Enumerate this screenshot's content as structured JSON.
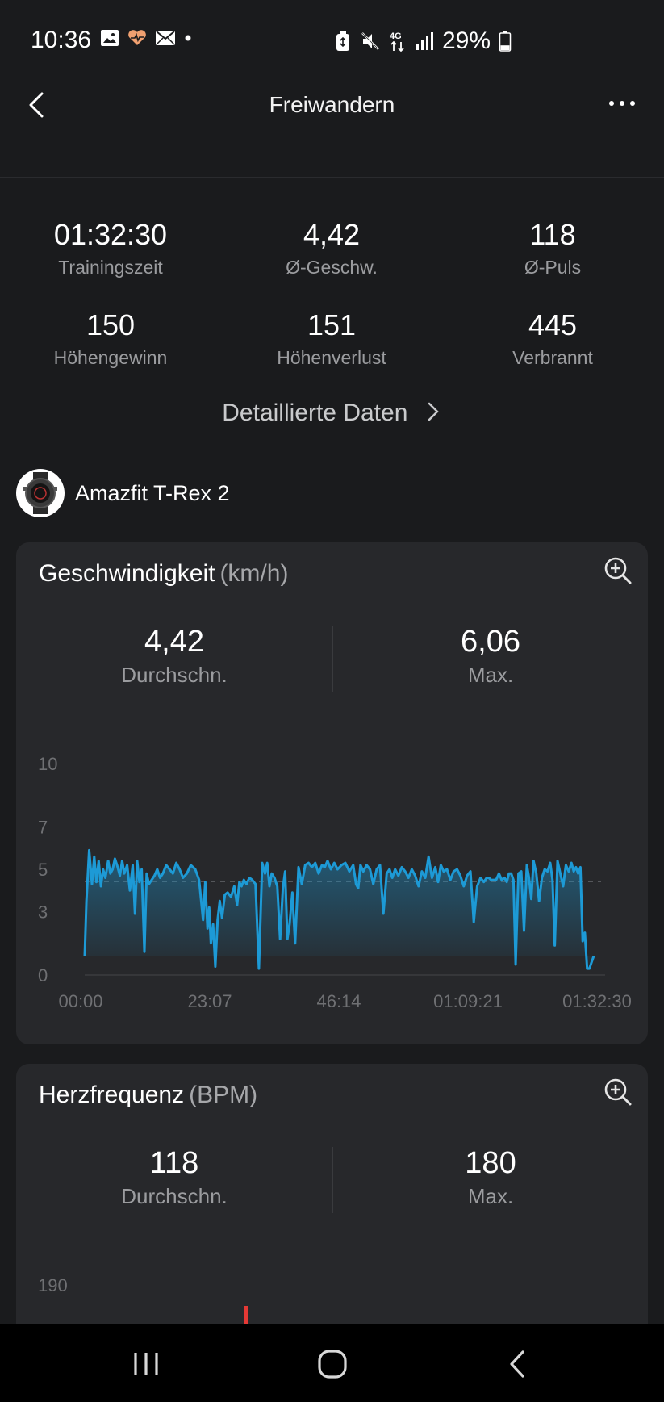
{
  "status_bar": {
    "time": "10:36",
    "network": "4G",
    "battery_percent": "29%",
    "battery_level": 0.29
  },
  "header": {
    "title": "Freiwandern"
  },
  "summary": [
    {
      "value": "01:32:30",
      "label": "Trainingszeit"
    },
    {
      "value": "4,42",
      "label": "Ø-Geschw."
    },
    {
      "value": "118",
      "label": "Ø-Puls"
    },
    {
      "value": "150",
      "label": "Höhengewinn"
    },
    {
      "value": "151",
      "label": "Höhenverlust"
    },
    {
      "value": "445",
      "label": "Verbrannt"
    }
  ],
  "detail_link": "Detaillierte Daten",
  "device": {
    "name": "Amazfit T-Rex 2"
  },
  "speed_card": {
    "title": "Geschwindigkeit",
    "unit": "(km/h)",
    "avg_value": "4,42",
    "avg_label": "Durchschn.",
    "max_value": "6,06",
    "max_label": "Max."
  },
  "heart_card": {
    "title": "Herzfrequenz",
    "unit": "(BPM)",
    "avg_value": "118",
    "avg_label": "Durchschn.",
    "max_value": "180",
    "max_label": "Max.",
    "y_tick": "190"
  },
  "chart_data": {
    "type": "area",
    "title": "Geschwindigkeit (km/h)",
    "xlabel": "",
    "ylabel": "",
    "y_ticks": [
      "0",
      "3",
      "5",
      "7",
      "10"
    ],
    "x_ticks": [
      "00:00",
      "23:07",
      "46:14",
      "01:09:21",
      "01:32:30"
    ],
    "ylim": [
      0,
      10
    ],
    "xlim_minutes": [
      0,
      92.5
    ],
    "color": "#1d9ad6",
    "series": [
      {
        "x_minutes": [
          0,
          0.3,
          0.8,
          1.3,
          1.7,
          2.1,
          2.5,
          2.9,
          3.3,
          3.7,
          4.2,
          4.6,
          5.0,
          5.4,
          5.8,
          6.3,
          6.7,
          7.1,
          7.6,
          8.1,
          8.6,
          9.0,
          9.4,
          9.8,
          10.2,
          10.7,
          11.1,
          11.5,
          12.0,
          12.5,
          13.0,
          13.5,
          14.0,
          14.6,
          15.2,
          15.8,
          16.4,
          17.0,
          17.6,
          18.3,
          19.0,
          19.8,
          20.5,
          21.2,
          21.6,
          22.0,
          22.3,
          22.6,
          23.0,
          23.4,
          23.8,
          24.2,
          24.6,
          25.1,
          25.6,
          26.2,
          26.8,
          27.3,
          27.7,
          28.1,
          28.5,
          29.0,
          29.5,
          30.0,
          30.6,
          31.2,
          31.8,
          32.3,
          32.7,
          33.1,
          33.5,
          34.0,
          34.5,
          35.0,
          35.5,
          35.9,
          36.3,
          36.7,
          37.2,
          37.7,
          38.3,
          38.9,
          39.5,
          40.1,
          40.7,
          41.3,
          41.9,
          42.5,
          43.0,
          43.5,
          44.1,
          44.7,
          45.3,
          46.0,
          46.7,
          47.4,
          48.1,
          48.6,
          49.0,
          49.4,
          49.9,
          50.5,
          51.1,
          51.7,
          52.3,
          52.9,
          53.5,
          54.1,
          54.6,
          55.1,
          55.6,
          56.2,
          56.8,
          57.4,
          58.0,
          58.6,
          59.2,
          59.8,
          60.4,
          61.0,
          61.6,
          62.2,
          62.8,
          63.3,
          63.8,
          64.3,
          64.9,
          65.5,
          66.1,
          66.7,
          67.3,
          67.9,
          68.5,
          69.1,
          69.7,
          70.3,
          70.9,
          71.5,
          72.0,
          72.4,
          72.8,
          73.2,
          73.7,
          74.2,
          74.7,
          75.2,
          75.6,
          76.0,
          76.4,
          76.8,
          77.2,
          77.7,
          78.2,
          78.7,
          79.2,
          79.6,
          80.0,
          80.4,
          80.9,
          81.4,
          81.9,
          82.4,
          82.9,
          83.4,
          83.8,
          84.2,
          84.7,
          85.2,
          85.7,
          86.2,
          86.7,
          87.2,
          87.6,
          88.0,
          88.4,
          88.8,
          89.2,
          89.6,
          90.0,
          90.4,
          90.8,
          91.2,
          91.6,
          92.0,
          92.5
        ],
        "values": [
          0.9,
          3.5,
          5.9,
          4.3,
          5.6,
          4.4,
          5.4,
          4.2,
          5.0,
          4.6,
          5.4,
          4.8,
          5.0,
          5.5,
          5.2,
          4.7,
          5.4,
          4.8,
          5.2,
          4.0,
          5.2,
          2.9,
          5.4,
          4.4,
          5.0,
          1.1,
          4.8,
          4.3,
          4.5,
          4.7,
          5.0,
          4.6,
          4.8,
          5.2,
          5.0,
          4.8,
          5.3,
          5.0,
          4.6,
          4.8,
          5.2,
          5.0,
          4.5,
          2.6,
          4.4,
          2.2,
          3.2,
          1.5,
          2.4,
          0.4,
          2.6,
          3.5,
          2.7,
          3.8,
          3.9,
          3.7,
          4.2,
          3.3,
          4.4,
          4.2,
          4.5,
          4.3,
          4.6,
          4.5,
          4.3,
          0.3,
          5.3,
          4.8,
          5.3,
          4.2,
          4.8,
          4.6,
          4.2,
          1.7,
          4.1,
          4.9,
          1.7,
          2.4,
          3.9,
          1.5,
          5.1,
          4.3,
          5.2,
          5.3,
          5.1,
          5.3,
          4.8,
          5.2,
          5.1,
          5.4,
          5.0,
          5.3,
          5.0,
          5.2,
          5.3,
          4.9,
          5.2,
          4.3,
          4.1,
          5.2,
          4.9,
          5.2,
          5.0,
          4.3,
          5.0,
          5.2,
          2.9,
          4.8,
          5.0,
          4.6,
          5.0,
          4.7,
          5.1,
          4.9,
          4.6,
          5.0,
          4.7,
          4.2,
          4.9,
          4.6,
          5.6,
          4.6,
          5.1,
          4.4,
          5.2,
          4.9,
          5.0,
          4.5,
          4.9,
          5.0,
          4.7,
          4.2,
          4.7,
          4.9,
          2.5,
          4.2,
          4.6,
          4.4,
          4.6,
          4.6,
          4.5,
          4.5,
          4.5,
          4.8,
          4.5,
          4.6,
          4.4,
          4.8,
          4.8,
          4.5,
          0.5,
          4.8,
          4.9,
          2.1,
          5.2,
          4.6,
          3.6,
          5.4,
          4.8,
          3.5,
          4.6,
          5.0,
          4.9,
          5.3,
          4.5,
          1.4,
          5.4,
          4.8,
          4.2,
          5.2,
          4.9,
          5.3,
          4.9,
          5.1,
          4.8,
          5.1,
          1.6,
          2.0,
          0.3,
          0.3,
          0.6,
          0.9
        ]
      }
    ]
  }
}
